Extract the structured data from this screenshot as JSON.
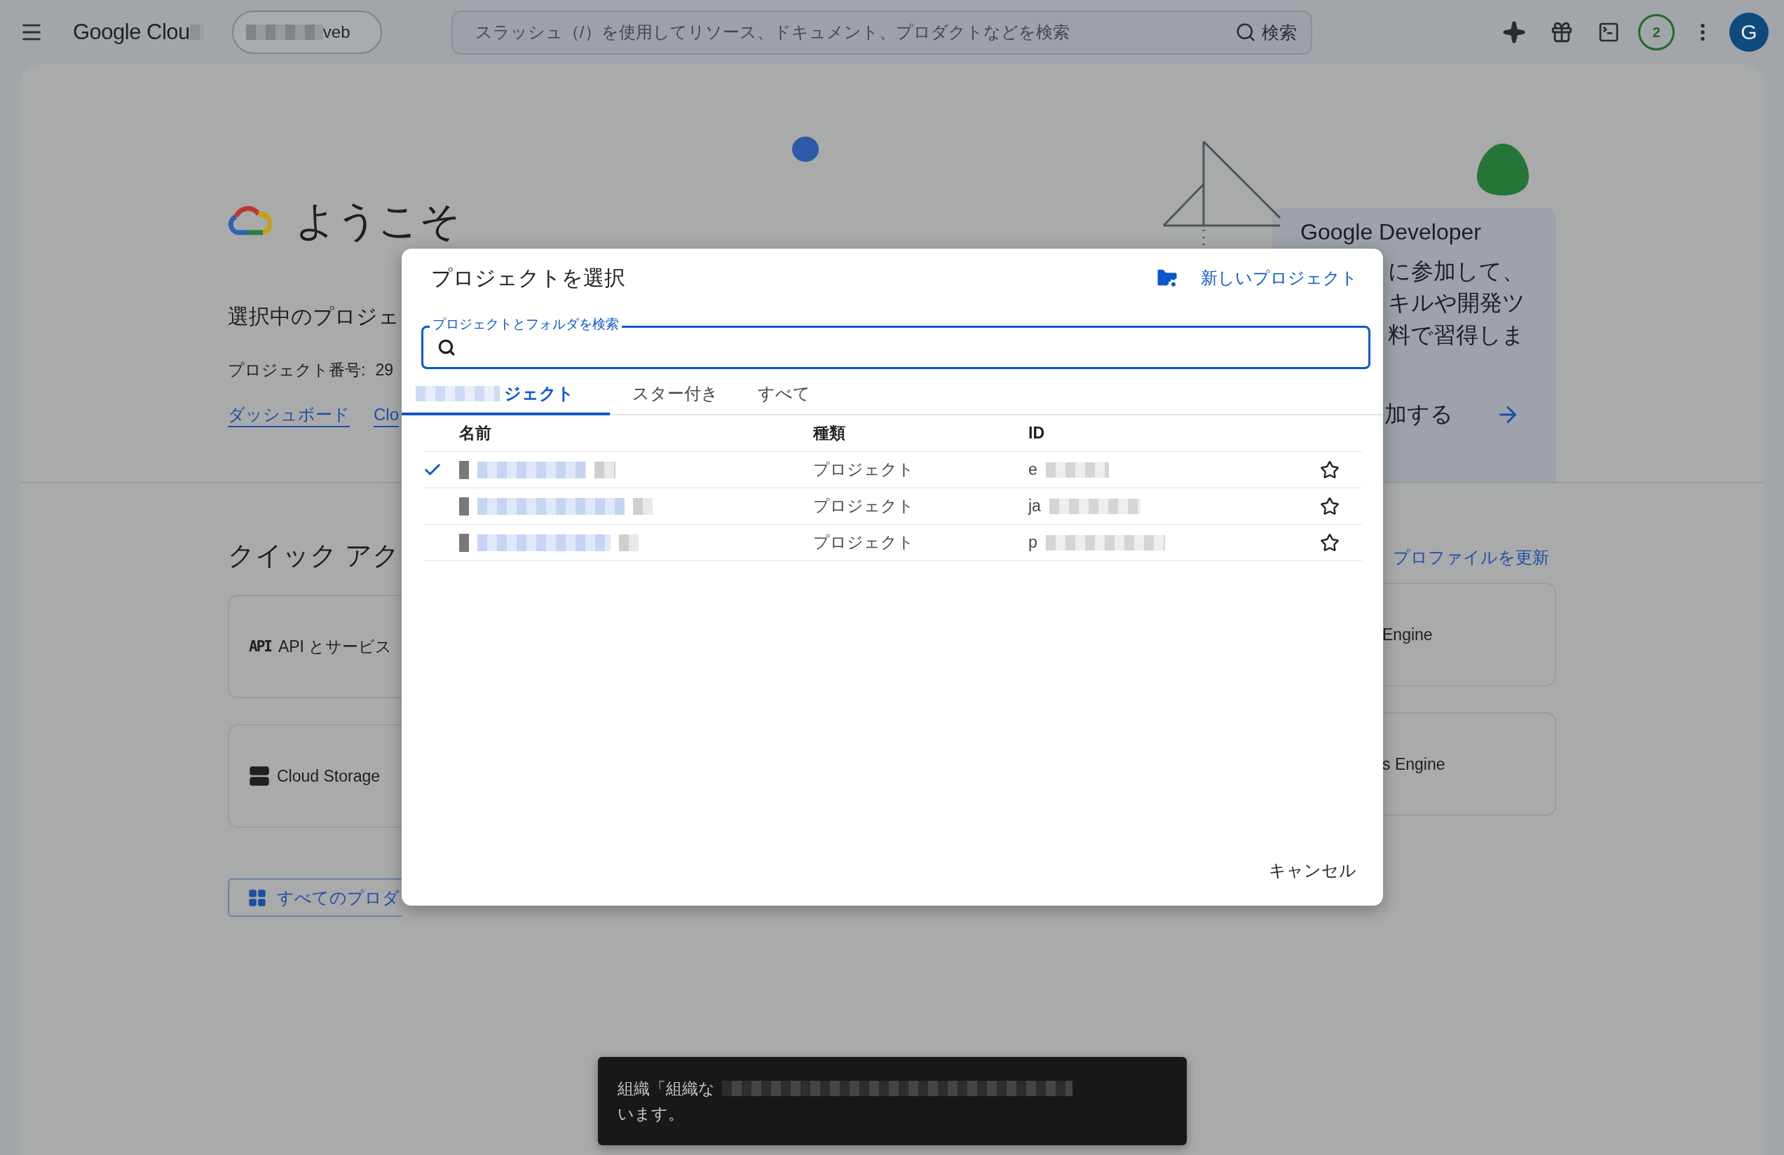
{
  "topbar": {
    "logo_text": "Google Clou",
    "project_picker": "veb",
    "search": {
      "placeholder": "スラッシュ（/）を使用してリソース、ドキュメント、プロダクトなどを検索",
      "button": "検索"
    },
    "notification_count": "2",
    "avatar": "G"
  },
  "welcome": {
    "title": "ようこそ",
    "selected_project": "選択中のプロジェ",
    "project_number_label": "プロジェクト番号:",
    "project_number": "29",
    "links": [
      "ダッシュボード",
      "Clo"
    ]
  },
  "promo": {
    "title": "Google Developer",
    "lines": [
      "に参加して、",
      "キルや開発ツ",
      "料で習得しま"
    ],
    "action": "加する"
  },
  "quick_access": {
    "title": "クイック アク",
    "cards": [
      {
        "kind": "api",
        "icon_text": "API",
        "label": "API とサービス"
      },
      {
        "kind": "storage",
        "label": "Cloud Storage"
      }
    ],
    "all_products": "すべてのプロダ"
  },
  "profile_link": "プロファイルを更新",
  "right_cards": [
    "Engine",
    "s Engine"
  ],
  "dialog": {
    "title": "プロジェクトを選択",
    "new_project": "新しいプロジェクト",
    "search_label": "プロジェクトとフォルダを検索",
    "tabs": [
      {
        "label": "ジェクト",
        "selected": true
      },
      {
        "label": "スター付き",
        "selected": false
      },
      {
        "label": "すべて",
        "selected": false
      }
    ],
    "columns": [
      "名前",
      "種類",
      "ID"
    ],
    "rows": [
      {
        "selected": true,
        "type": "プロジェクト",
        "id": "e",
        "starred": false
      },
      {
        "selected": false,
        "type": "プロジェクト",
        "id": "ja",
        "starred": false
      },
      {
        "selected": false,
        "type": "プロジェクト",
        "id": "p",
        "starred": false
      }
    ],
    "cancel": "キャンセル"
  },
  "snackbar": {
    "lines": [
      "組織「組織な",
      "います。"
    ]
  }
}
